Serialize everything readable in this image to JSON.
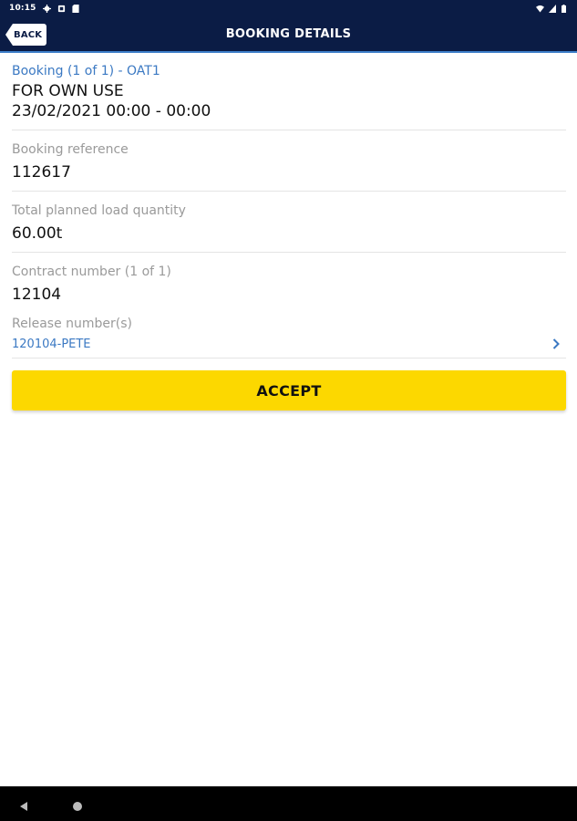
{
  "status_bar": {
    "time": "10:15",
    "icons": [
      "settings-icon",
      "notification-icon",
      "sd-card-icon",
      "wifi-icon",
      "signal-icon",
      "battery-icon"
    ]
  },
  "header": {
    "back_label": "BACK",
    "title": "BOOKING DETAILS"
  },
  "booking": {
    "heading": "Booking (1 of 1) - OAT1",
    "purpose": "FOR OWN USE",
    "time_range": "23/02/2021 00:00 - 00:00"
  },
  "fields": {
    "reference_label": "Booking reference",
    "reference_value": "112617",
    "quantity_label": "Total planned load quantity",
    "quantity_value": "60.00t",
    "contract_label": "Contract number (1 of 1)",
    "contract_value": "12104",
    "release_label": "Release number(s)",
    "release_value": "120104-PETE"
  },
  "actions": {
    "accept_label": "ACCEPT"
  },
  "navigation": {
    "icons": [
      "nav-back-icon",
      "nav-home-icon"
    ]
  },
  "colors": {
    "header_bg": "#0b1c45",
    "accent_blue": "#3b79c3",
    "accept_yellow": "#fcd800"
  }
}
